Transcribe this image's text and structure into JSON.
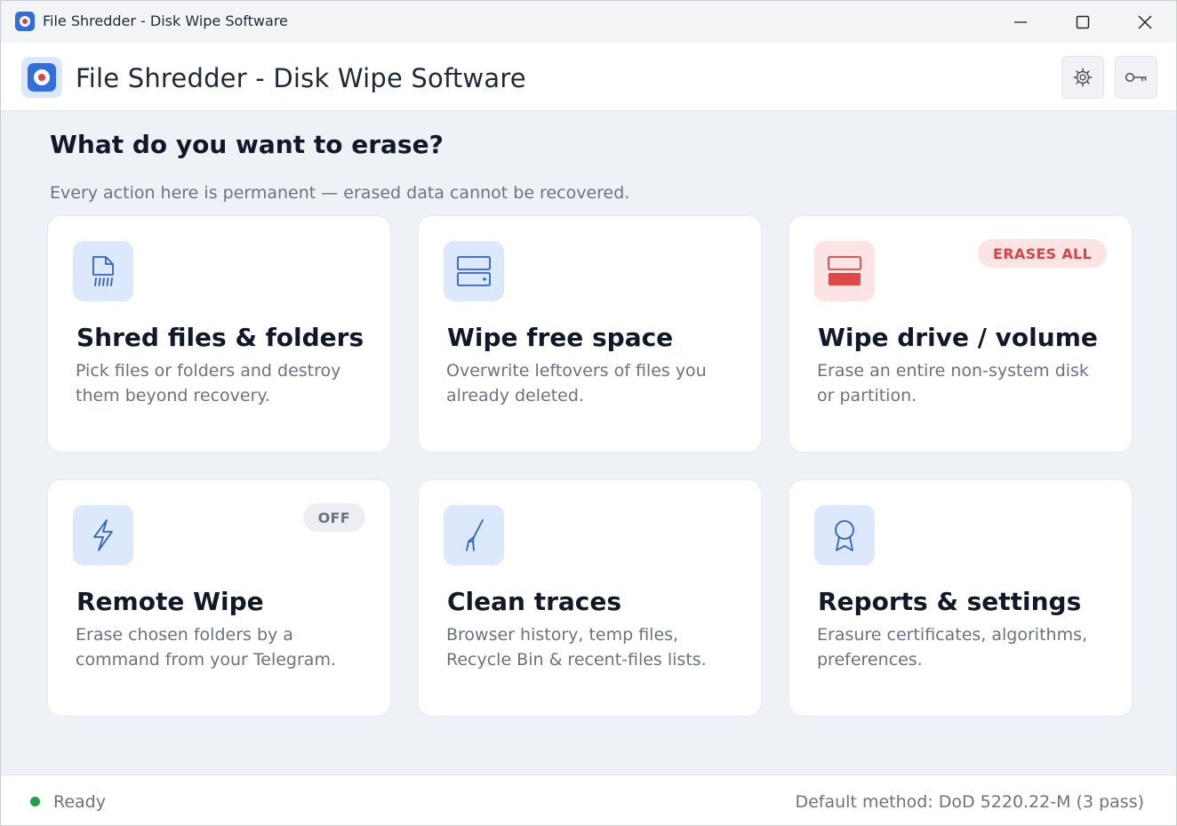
{
  "window": {
    "title": "File Shredder - Disk Wipe Software"
  },
  "header": {
    "app_title": "File Shredder - Disk Wipe Software"
  },
  "main": {
    "heading": "What do you want to erase?",
    "subheading": "Every action here is permanent — erased data cannot be recovered.",
    "cards": [
      {
        "title": "Shred files & folders",
        "description": "Pick files or folders and destroy them beyond recovery.",
        "icon": "shred-file-icon"
      },
      {
        "title": "Wipe free space",
        "description": "Overwrite leftovers of files you already deleted.",
        "icon": "drive-icon"
      },
      {
        "title": "Wipe drive / volume",
        "description": "Erase an entire non-system disk or partition.",
        "icon": "drive-erase-icon",
        "badge": "ERASES ALL"
      },
      {
        "title": "Remote Wipe",
        "description": "Erase chosen folders by a command from your Telegram.",
        "icon": "lightning-icon",
        "badge": "OFF"
      },
      {
        "title": "Clean traces",
        "description": "Browser history, temp files, Recycle Bin & recent-files lists.",
        "icon": "broom-icon"
      },
      {
        "title": "Reports & settings",
        "description": "Erasure certificates, algorithms, preferences.",
        "icon": "award-icon"
      }
    ]
  },
  "status": {
    "state": "Ready",
    "method": "Default method: DoD 5220.22-M (3 pass)"
  },
  "colors": {
    "accent": "#2f6fdd",
    "danger": "#d64545",
    "ready": "#21a04a",
    "background": "#eef1f6"
  }
}
